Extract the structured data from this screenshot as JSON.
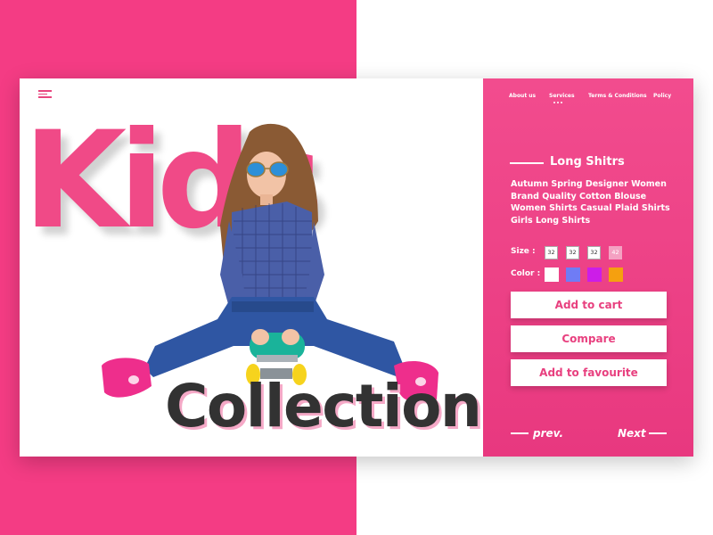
{
  "theme": {
    "accent": "#f43c84",
    "text_dark": "#323232"
  },
  "icons": {
    "menu": "hamburger-menu-icon"
  },
  "hero": {
    "word1": "Kids",
    "word2": "Collection"
  },
  "nav": {
    "items": [
      "About us",
      "Services",
      "Terms & Conditions",
      "Policy"
    ],
    "active_index": 1
  },
  "product": {
    "title": "Long Shitrs",
    "description": "Autumn Spring Designer Women Brand Quality Cotton Blouse Women Shirts Casual Plaid Shirts Girls Long Shirts",
    "size_label": "Size :",
    "sizes": [
      "32",
      "32",
      "32",
      "42"
    ],
    "unavailable_size_index": 3,
    "color_label": "Color :",
    "colors": [
      "#ffffff",
      "#6f7cf5",
      "#cc1de8",
      "#f5a00f"
    ]
  },
  "actions": {
    "add_to_cart": "Add to cart",
    "compare": "Compare",
    "add_to_favourite": "Add to favourite"
  },
  "pager": {
    "prev": "prev.",
    "next": "Next"
  }
}
